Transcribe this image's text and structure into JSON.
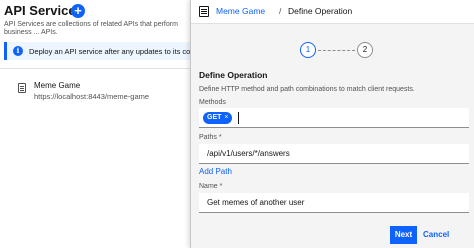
{
  "background": {
    "title": "API Services",
    "add_icon": "+",
    "description": "API Services are collections of related APIs that perform business ... APIs.",
    "banner": {
      "icon": "i",
      "text": "Deploy an API service after any updates to its conf"
    },
    "service": {
      "name": "Meme Game",
      "url": "https://localhost:8443/meme-game"
    }
  },
  "panel": {
    "breadcrumb": {
      "parent": "Meme Game",
      "separator": "/",
      "current": "Define Operation"
    },
    "steps": [
      "1",
      "2"
    ],
    "section_title": "Define Operation",
    "section_description": "Define HTTP method and path combinations to match client requests.",
    "methods": {
      "label": "Methods",
      "selected": "GET",
      "remove_glyph": "×"
    },
    "paths": {
      "label": "Paths *",
      "value": "/api/v1/users/*/answers"
    },
    "add_path_label": "Add Path",
    "name": {
      "label": "Name *",
      "value": "Get memes of another user"
    },
    "buttons": {
      "next": "Next",
      "cancel": "Cancel"
    }
  },
  "colors": {
    "primary": "#0f62fe",
    "text": "#161616",
    "secondary_text": "#525252",
    "panel_bg": "#f4f4f4"
  }
}
